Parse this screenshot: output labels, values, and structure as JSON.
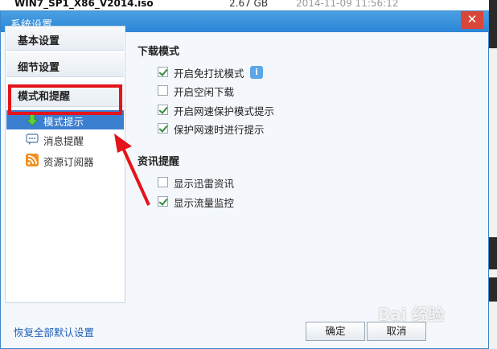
{
  "background": {
    "file_name": "WIN7_SP1_X86_V2014.iso",
    "file_size": "2.67 GB",
    "file_date": "2014-11-09 11:56:12"
  },
  "dialog": {
    "title": "系统设置",
    "close_glyph": "✕"
  },
  "sidebar": {
    "categories": [
      "基本设置",
      "细节设置",
      "模式和提醒"
    ],
    "subitems": [
      "模式提示",
      "消息提醒",
      "资源订阅器"
    ]
  },
  "download_mode": {
    "title": "下载模式",
    "options": [
      {
        "label": "开启免打扰模式",
        "checked": true
      },
      {
        "label": "开启空闲下载",
        "checked": false
      },
      {
        "label": "开启网速保护模式提示",
        "checked": true
      },
      {
        "label": "保护网速时进行提示",
        "checked": true
      }
    ],
    "info_glyph": "i"
  },
  "news": {
    "title": "资讯提醒",
    "options": [
      {
        "label": "显示迅雷资讯",
        "checked": false
      },
      {
        "label": "显示流量监控",
        "checked": true
      }
    ]
  },
  "footer": {
    "restore_label": "恢复全部默认设置",
    "ok_label": "确定",
    "cancel_label": "取消"
  },
  "watermark": "Bai 经验",
  "colors": {
    "titlebar": "#2b86d6",
    "active_item": "#3b7fd1",
    "highlight": "#e4141a",
    "check": "#2f8a3a"
  }
}
